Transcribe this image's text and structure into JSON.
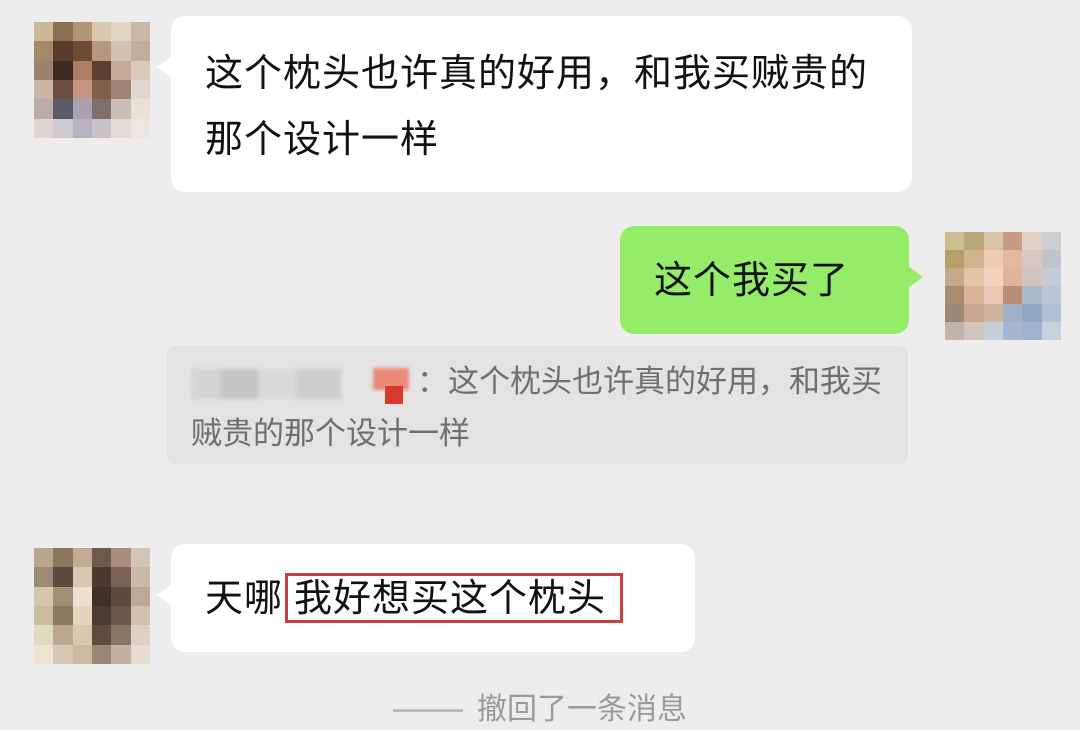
{
  "messages": [
    {
      "side": "received",
      "text": "这个枕头也许真的好用，和我买贼贵的那个设计一样"
    },
    {
      "side": "sent",
      "text": "这个我买了"
    },
    {
      "side": "sent-quote",
      "quote_text": "：这个枕头也许真的好用，和我买贼贵的那个设计一样"
    },
    {
      "side": "received",
      "text_prefix": "天哪",
      "text_highlighted": "我好想买这个枕头"
    }
  ],
  "system_notice": "撤回了一条消息",
  "colors": {
    "background": "#ededed",
    "incoming_bubble": "#ffffff",
    "outgoing_bubble": "#95ec69",
    "quote_background": "#e3e3e3",
    "highlight_border": "#c9403a"
  }
}
